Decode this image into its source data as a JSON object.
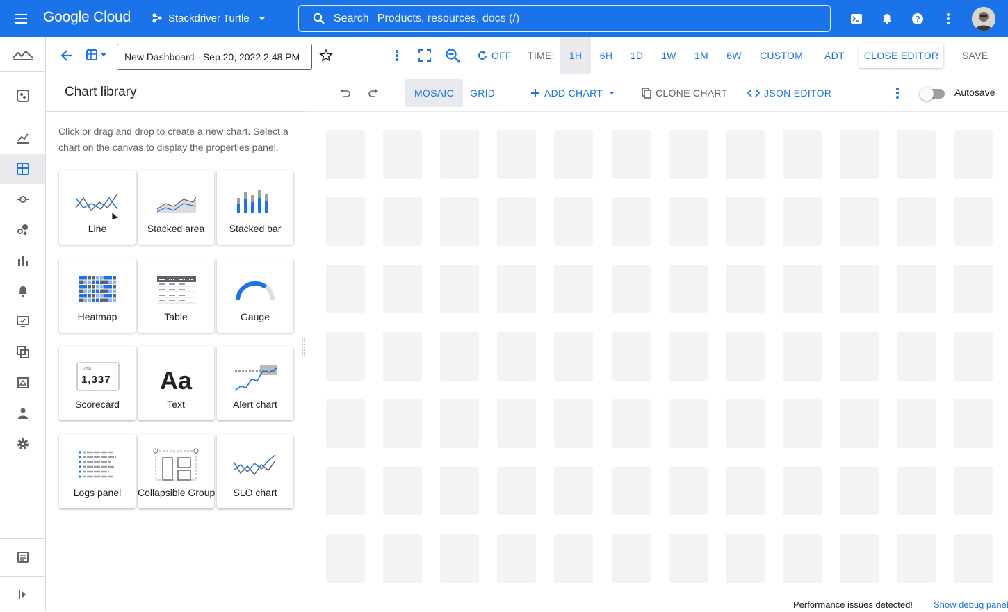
{
  "topbar": {
    "brand": "Google Cloud",
    "project": "Stackdriver Turtle",
    "search_label": "Search",
    "search_placeholder": "Products, resources, docs (/)"
  },
  "toolbar": {
    "dashboard_name": "New Dashboard - Sep 20, 2022 2:48 PM",
    "auto_refresh": "OFF",
    "time_label": "TIME:",
    "ranges": [
      "1H",
      "6H",
      "1D",
      "1W",
      "1M",
      "6W"
    ],
    "selected_range": "1H",
    "custom": "CUSTOM",
    "timezone": "ADT",
    "close_editor": "CLOSE EDITOR",
    "save": "SAVE"
  },
  "library": {
    "title": "Chart library",
    "description": "Click or drag and drop to create a new chart. Select a chart on the canvas to display the properties panel.",
    "charts": [
      {
        "label": "Line",
        "icon": "line-chart-icon"
      },
      {
        "label": "Stacked area",
        "icon": "stacked-area-icon"
      },
      {
        "label": "Stacked bar",
        "icon": "stacked-bar-icon"
      },
      {
        "label": "Heatmap",
        "icon": "heatmap-icon"
      },
      {
        "label": "Table",
        "icon": "table-icon"
      },
      {
        "label": "Gauge",
        "icon": "gauge-icon"
      },
      {
        "label": "Scorecard",
        "icon": "scorecard-icon"
      },
      {
        "label": "Text",
        "icon": "text-icon"
      },
      {
        "label": "Alert chart",
        "icon": "alert-chart-icon"
      },
      {
        "label": "Logs panel",
        "icon": "logs-panel-icon"
      },
      {
        "label": "Collapsible Group",
        "icon": "collapsible-group-icon"
      },
      {
        "label": "SLO chart",
        "icon": "slo-chart-icon"
      }
    ],
    "scorecard_preview": {
      "caption": "Total",
      "value": "1,337"
    },
    "text_preview": "Aa"
  },
  "canvas": {
    "mosaic": "MOSAIC",
    "grid": "GRID",
    "add_chart": "ADD CHART",
    "clone_chart": "CLONE CHART",
    "json_editor": "JSON EDITOR",
    "autosave_label": "Autosave",
    "autosave_on": false
  },
  "status": {
    "message": "Performance issues detected!",
    "debug_link": "Show debug panel"
  },
  "colors": {
    "brand_blue": "#1a73e8",
    "placeholder_cell": "#f1f3f4",
    "border": "#dadce0"
  }
}
